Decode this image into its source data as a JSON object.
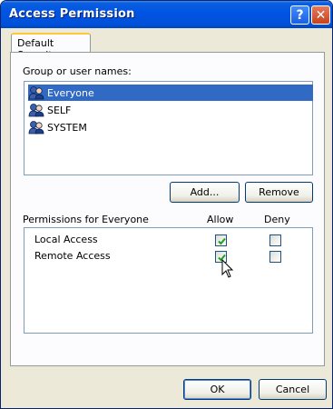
{
  "window": {
    "title": "Access Permission",
    "help_glyph": "?",
    "close_glyph": "✕"
  },
  "tabs": [
    {
      "label": "Default Security",
      "active": true
    }
  ],
  "group_section": {
    "label": "Group or user names:",
    "items": [
      {
        "label": "Everyone",
        "selected": true,
        "icon": "user-group-icon"
      },
      {
        "label": "SELF",
        "selected": false,
        "icon": "user-group-icon"
      },
      {
        "label": "SYSTEM",
        "selected": false,
        "icon": "user-group-icon"
      }
    ],
    "add_label": "Add...",
    "remove_label": "Remove"
  },
  "permissions": {
    "header_label": "Permissions for Everyone",
    "allow_label": "Allow",
    "deny_label": "Deny",
    "rows": [
      {
        "label": "Local Access",
        "allow": true,
        "deny": false
      },
      {
        "label": "Remote Access",
        "allow": true,
        "deny": false
      }
    ]
  },
  "footer": {
    "ok_label": "OK",
    "cancel_label": "Cancel"
  },
  "colors": {
    "title_bar": "#0054e3",
    "selection": "#316ac5",
    "dialog_bg": "#ece9d8",
    "check_mark": "#21a121"
  }
}
